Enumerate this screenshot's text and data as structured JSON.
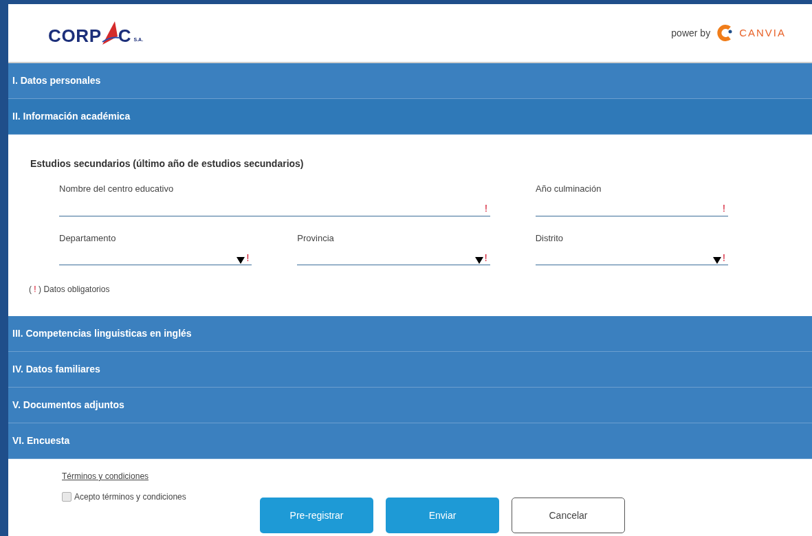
{
  "header": {
    "logo": {
      "left": "CORP",
      "right": "C",
      "suffix": "S.A."
    },
    "powered": {
      "label": "power by",
      "brand": "CANVIA"
    }
  },
  "sections": [
    {
      "title": "I. Datos personales",
      "expanded": false
    },
    {
      "title": "II. Información académica",
      "expanded": true,
      "content": {
        "heading": "Estudios secundarios (último año de estudios secundarios)",
        "school_row": {
          "fields": [
            {
              "kind": "text",
              "label": "Nombre del centro educativo",
              "required_mark": "!"
            },
            {
              "kind": "text",
              "label": "Año culminación",
              "required_mark": "!"
            }
          ]
        },
        "location_row": {
          "fields": [
            {
              "kind": "select",
              "label": "Departamento",
              "required_mark": "!"
            },
            {
              "kind": "select",
              "label": "Provincia",
              "required_mark": "!"
            },
            {
              "kind": "select",
              "label": "Distrito",
              "required_mark": "!"
            }
          ]
        },
        "note": {
          "open": "(",
          "mark": "!",
          "close": ")",
          "text": "Datos obligatorios"
        }
      }
    },
    {
      "title": "III. Competencias linguisticas en inglés",
      "expanded": false
    },
    {
      "title": "IV. Datos familiares",
      "expanded": false
    },
    {
      "title": "V. Documentos adjuntos",
      "expanded": false
    },
    {
      "title": "VI. Encuesta",
      "expanded": false
    }
  ],
  "footer": {
    "terms_link": "Términos y condiciones",
    "accept": {
      "label": "Acepto términos y condiciones",
      "checked": false
    },
    "buttons": [
      {
        "label": "Pre-registrar",
        "kind": "primary"
      },
      {
        "label": "Enviar",
        "kind": "primary"
      },
      {
        "label": "Cancelar",
        "kind": "secondary"
      }
    ]
  }
}
